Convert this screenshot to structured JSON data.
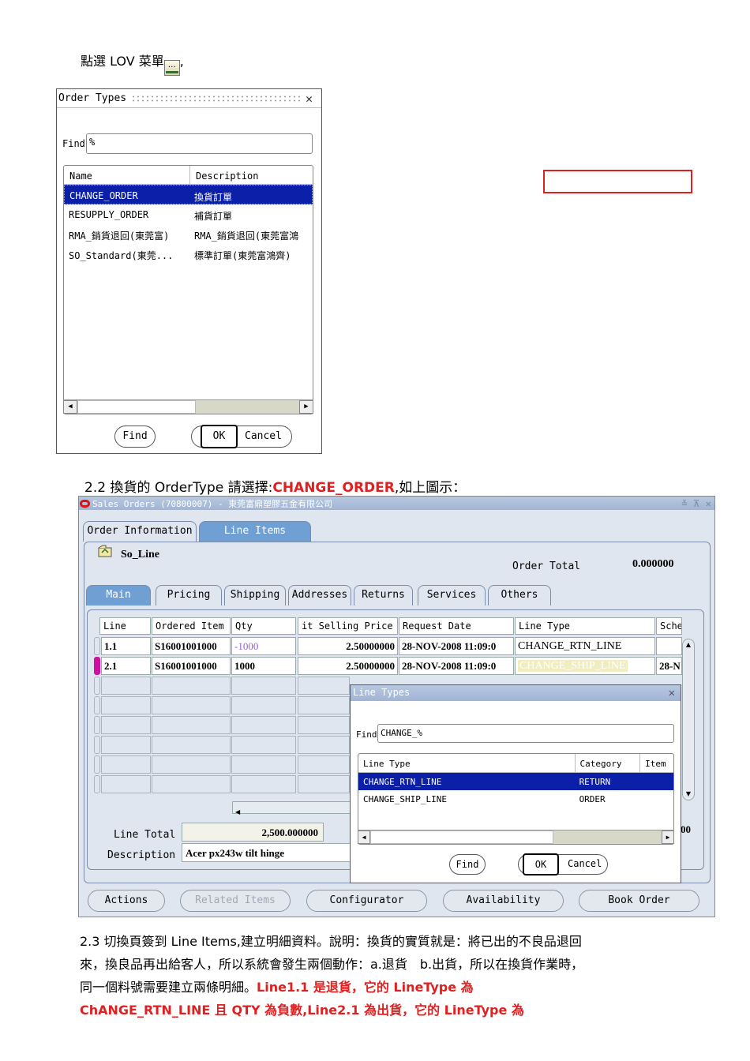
{
  "intro": {
    "text": "點選 LOV 菜單",
    "suffix": ","
  },
  "order_types_dialog": {
    "title": "Order Types",
    "find_label": "Find",
    "find_value": "%",
    "columns": [
      "Name",
      "Description"
    ],
    "rows": [
      {
        "name": "CHANGE_ORDER",
        "description": "換貨訂單",
        "selected": true
      },
      {
        "name": "RESUPPLY_ORDER",
        "description": "補貨訂單",
        "selected": false
      },
      {
        "name": "RMA_銷貨退回(東莞富)",
        "description": "RMA_銷貨退回(東莞富鴻",
        "selected": false
      },
      {
        "name": "SO_Standard(東莞...",
        "description": "標準訂單(東莞富鴻齊)",
        "selected": false
      }
    ],
    "buttons": {
      "find": "Find",
      "ok": "OK",
      "cancel": "Cancel"
    }
  },
  "caption_2_2": {
    "prefix": "2.2 換貨的 OrderType 請選擇:",
    "highlight": "CHANGE_ORDER",
    "suffix": ",如上圖示："
  },
  "sales_orders": {
    "title": "Sales Orders (70800007) - 東莞富鼎塑膠五金有限公司",
    "window_controls": "≚ ⊼ ✕",
    "top_tabs": [
      "Order Information",
      "Line Items"
    ],
    "so_line": "So_Line",
    "order_total_label": "Order Total",
    "order_total_value": "0.000000",
    "sub_tabs": [
      "Main",
      "Pricing",
      "Shipping",
      "Addresses",
      "Returns",
      "Services",
      "Others"
    ],
    "grid_headers": [
      "Line",
      "Ordered Item",
      "Qty",
      "it Selling Price",
      "Request Date",
      "Line Type",
      "Sche"
    ],
    "rows": [
      {
        "line": "1.1",
        "item": "S16001001000",
        "qty": "-1000",
        "price": "2.50000000",
        "date": "28-NOV-2008 11:09:0",
        "line_type": "CHANGE_RTN_LINE",
        "sched": ""
      },
      {
        "line": "2.1",
        "item": "S16001001000",
        "qty": "1000",
        "price": "2.50000000",
        "date": "28-NOV-2008 11:09:0",
        "line_type": "CHANGE_SHIP_LINE",
        "sched": "28-N"
      }
    ],
    "line_total_label": "Line Total",
    "line_total_value": "2,500.000000",
    "description_label": "Description",
    "description_value": "Acer px243w tilt hinge",
    "side_value": "00",
    "bottom_buttons": {
      "actions": "Actions",
      "related": "Related Items",
      "configurator": "Configurator",
      "availability": "Availability",
      "book": "Book Order"
    },
    "colors": {
      "active_tab": "#6f9fd3",
      "selection": "#0b1fa8",
      "negative_qty": "#9a5fd0",
      "current_row": "#d010a0"
    }
  },
  "line_types_dialog": {
    "title": "Line Types",
    "find_label": "Find",
    "find_value": "CHANGE_%",
    "columns": [
      "Line Type",
      "Category",
      "Item"
    ],
    "rows": [
      {
        "line_type": "CHANGE_RTN_LINE",
        "category": "RETURN",
        "item": "",
        "selected": true
      },
      {
        "line_type": "CHANGE_SHIP_LINE",
        "category": "ORDER",
        "item": "",
        "selected": false
      }
    ],
    "buttons": {
      "find": "Find",
      "ok": "OK",
      "cancel": "Cancel"
    }
  },
  "bottom_text": {
    "line1": "2.3 切換頁簽到 Line Items,建立明細資料。說明：換貨的實質就是：將已出的不良品退回",
    "line2": "來，換良品再出給客人，所以系統會發生兩個動作：a.退貨　b.出貨，所以在換貨作業時，",
    "line3_plain": "同一個料號需要建立兩條明細。",
    "line3_red": "Line1.1 是退貨，它的 LineType 為",
    "line4_red": "ChANGE_RTN_LINE 且 QTY 為負數,Line2.1 為出貨，它的 LineType 為"
  }
}
